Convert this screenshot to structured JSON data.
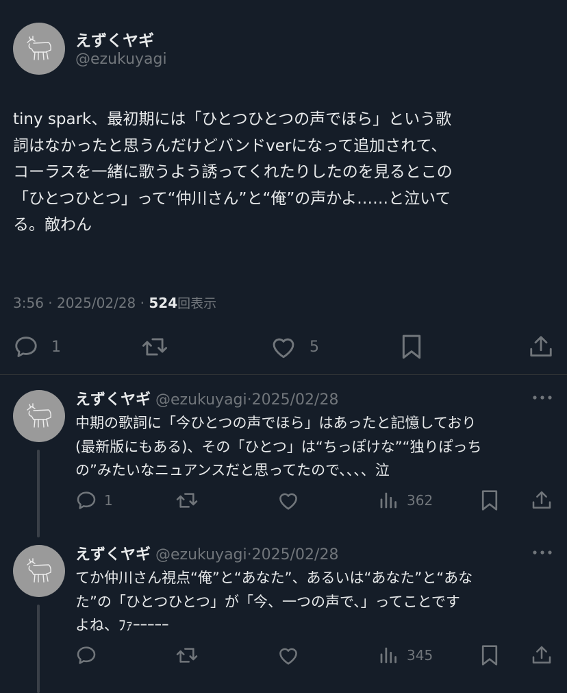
{
  "main_tweet": {
    "author_name": "えずくヤギ",
    "author_handle": "@ezukuyagi",
    "text": "tiny spark、最初期には「ひとつひとつの声でほら」という歌\n詞はなかったと思うんだけどバンドverになって追加されて、\nコーラスを一緒に歌うよう誘ってくれたりしたのを見るとこの\n「ひとつひとつ」って“仲川さん”と“俺”の声かよ……と泣いて\nる。敵わん",
    "time": "3:56",
    "sep": "·",
    "date": "2025/02/28",
    "views": "524",
    "views_label": "回表示",
    "reply_count": "1",
    "like_count": "5"
  },
  "replies": [
    {
      "author_name": "えずくヤギ",
      "author_handle": "@ezukuyagi",
      "sep": "·",
      "date": "2025/02/28",
      "text": "中期の歌詞に「今ひとつの声でほら」はあったと記憶しており\n(最新版にもある)、その「ひとつ」は“ちっぽけな”“独りぽっち\nの”みたいなニュアンスだと思ってたので、、、、泣",
      "reply_count": "1",
      "view_count": "362"
    },
    {
      "author_name": "えずくヤギ",
      "author_handle": "@ezukuyagi",
      "sep": "·",
      "date": "2025/02/28",
      "text": "てか仲川さん視点“俺”と“あなた”、あるいは“あなた”と“あな\nた”の「ひとつひとつ」が「今、一つの声で、」ってことです\nよね、ﾌｧｰｰｰｰｰ",
      "reply_count": "",
      "view_count": "345"
    }
  ],
  "icons": [
    "goat-avatar",
    "reply-icon",
    "retweet-icon",
    "like-icon",
    "bookmark-icon",
    "share-icon",
    "views-icon",
    "more-icon"
  ],
  "colors": {
    "background": "#151d28",
    "text": "#e7e9ea",
    "secondary": "#71767b",
    "divider": "#2f3336"
  }
}
